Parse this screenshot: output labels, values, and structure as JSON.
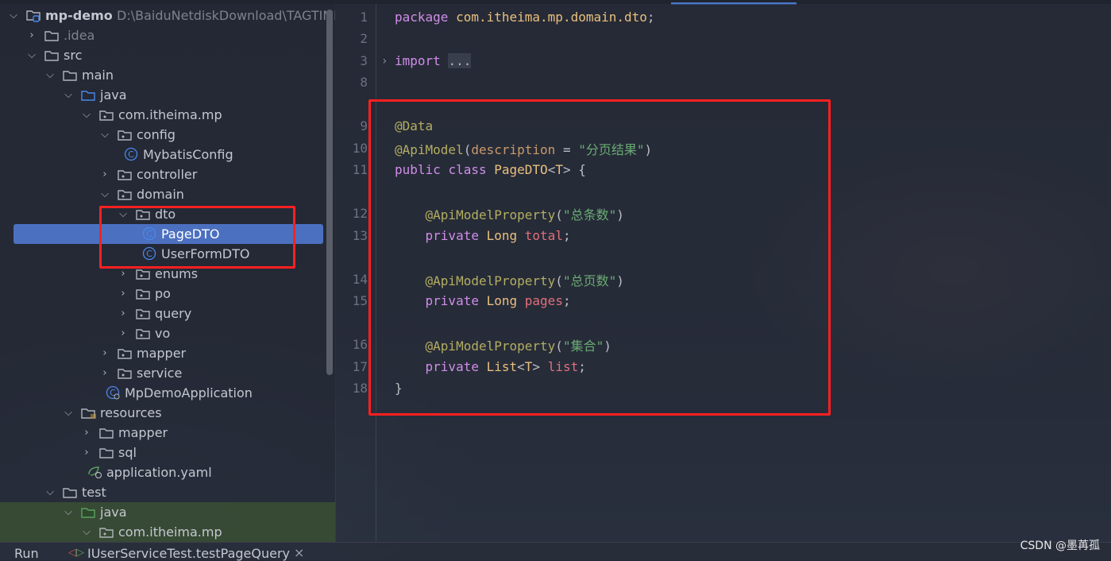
{
  "project": {
    "root_name": "mp-demo",
    "root_path": "D:\\BaiduNetdiskDownload\\TAGTIME",
    "items": [
      {
        "label": "mp-demo",
        "level": 0,
        "chev": "open",
        "icon": "module"
      },
      {
        "label": ".idea",
        "level": 1,
        "chev": "closed",
        "icon": "folder",
        "dim": true
      },
      {
        "label": "src",
        "level": 1,
        "chev": "open",
        "icon": "folder"
      },
      {
        "label": "main",
        "level": 2,
        "chev": "open",
        "icon": "folder"
      },
      {
        "label": "java",
        "level": 3,
        "chev": "open",
        "icon": "source-folder"
      },
      {
        "label": "com.itheima.mp",
        "level": 4,
        "chev": "open",
        "icon": "package"
      },
      {
        "label": "config",
        "level": 5,
        "chev": "open",
        "icon": "package"
      },
      {
        "label": "MybatisConfig",
        "level": 6,
        "chev": "none",
        "icon": "class"
      },
      {
        "label": "controller",
        "level": 5,
        "chev": "closed",
        "icon": "package"
      },
      {
        "label": "domain",
        "level": 5,
        "chev": "open",
        "icon": "package"
      },
      {
        "label": "dto",
        "level": 6,
        "chev": "open",
        "icon": "package"
      },
      {
        "label": "PageDTO",
        "level": 7,
        "chev": "none",
        "icon": "class",
        "selected": true
      },
      {
        "label": "UserFormDTO",
        "level": 7,
        "chev": "none",
        "icon": "class"
      },
      {
        "label": "enums",
        "level": 6,
        "chev": "closed",
        "icon": "package"
      },
      {
        "label": "po",
        "level": 6,
        "chev": "closed",
        "icon": "package"
      },
      {
        "label": "query",
        "level": 6,
        "chev": "closed",
        "icon": "package"
      },
      {
        "label": "vo",
        "level": 6,
        "chev": "closed",
        "icon": "package"
      },
      {
        "label": "mapper",
        "level": 5,
        "chev": "closed",
        "icon": "package"
      },
      {
        "label": "service",
        "level": 5,
        "chev": "closed",
        "icon": "package"
      },
      {
        "label": "MpDemoApplication",
        "level": 5,
        "chev": "none",
        "icon": "spring-class"
      },
      {
        "label": "resources",
        "level": 3,
        "chev": "open",
        "icon": "resources-folder"
      },
      {
        "label": "mapper",
        "level": 4,
        "chev": "closed",
        "icon": "folder"
      },
      {
        "label": "sql",
        "level": 4,
        "chev": "closed",
        "icon": "folder"
      },
      {
        "label": "application.yaml",
        "level": 4,
        "chev": "none",
        "icon": "spring-yaml"
      },
      {
        "label": "test",
        "level": 2,
        "chev": "open",
        "icon": "folder"
      },
      {
        "label": "java",
        "level": 3,
        "chev": "open",
        "icon": "test-folder",
        "green": true
      },
      {
        "label": "com.itheima.mp",
        "level": 4,
        "chev": "open",
        "icon": "package",
        "green": true
      }
    ]
  },
  "editor": {
    "lines": [
      {
        "n": "1",
        "tokens": [
          [
            "k",
            "package"
          ],
          [
            "d",
            " "
          ],
          [
            "t",
            "com.itheima.mp.domain.dto"
          ],
          [
            "d",
            ";"
          ]
        ]
      },
      {
        "n": "2",
        "tokens": []
      },
      {
        "n": "3",
        "fold": true,
        "tokens": [
          [
            "k",
            "import"
          ],
          [
            "d",
            " "
          ],
          [
            "m",
            "..."
          ]
        ]
      },
      {
        "n": "8",
        "tokens": []
      },
      {
        "n": "",
        "tokens": []
      },
      {
        "n": "9",
        "tokens": [
          [
            "a",
            "@Data"
          ]
        ]
      },
      {
        "n": "10",
        "tokens": [
          [
            "a",
            "@ApiModel"
          ],
          [
            "d",
            "("
          ],
          [
            "p",
            "description"
          ],
          [
            "d",
            " = "
          ],
          [
            "s",
            "\"分页结果\""
          ],
          [
            "d",
            ")"
          ]
        ]
      },
      {
        "n": "11",
        "tokens": [
          [
            "k",
            "public"
          ],
          [
            "d",
            " "
          ],
          [
            "k",
            "class"
          ],
          [
            "d",
            " "
          ],
          [
            "t",
            "PageDTO"
          ],
          [
            "d",
            "<"
          ],
          [
            "t",
            "T"
          ],
          [
            "d",
            "> {"
          ]
        ]
      },
      {
        "n": "",
        "tokens": []
      },
      {
        "n": "12",
        "tokens": [
          [
            "d",
            "    "
          ],
          [
            "a",
            "@ApiModelProperty"
          ],
          [
            "d",
            "("
          ],
          [
            "s",
            "\"总条数\""
          ],
          [
            "d",
            ")"
          ]
        ]
      },
      {
        "n": "13",
        "tokens": [
          [
            "d",
            "    "
          ],
          [
            "k",
            "private"
          ],
          [
            "d",
            " "
          ],
          [
            "t",
            "Long"
          ],
          [
            "d",
            " "
          ],
          [
            "f",
            "total"
          ],
          [
            "d",
            ";"
          ]
        ]
      },
      {
        "n": "",
        "tokens": []
      },
      {
        "n": "14",
        "tokens": [
          [
            "d",
            "    "
          ],
          [
            "a",
            "@ApiModelProperty"
          ],
          [
            "d",
            "("
          ],
          [
            "s",
            "\"总页数\""
          ],
          [
            "d",
            ")"
          ]
        ]
      },
      {
        "n": "15",
        "tokens": [
          [
            "d",
            "    "
          ],
          [
            "k",
            "private"
          ],
          [
            "d",
            " "
          ],
          [
            "t",
            "Long"
          ],
          [
            "d",
            " "
          ],
          [
            "f",
            "pages"
          ],
          [
            "d",
            ";"
          ]
        ]
      },
      {
        "n": "",
        "tokens": []
      },
      {
        "n": "16",
        "tokens": [
          [
            "d",
            "    "
          ],
          [
            "a",
            "@ApiModelProperty"
          ],
          [
            "d",
            "("
          ],
          [
            "s",
            "\"集合\""
          ],
          [
            "d",
            ")"
          ]
        ]
      },
      {
        "n": "17",
        "tokens": [
          [
            "d",
            "    "
          ],
          [
            "k",
            "private"
          ],
          [
            "d",
            " "
          ],
          [
            "t",
            "List"
          ],
          [
            "d",
            "<"
          ],
          [
            "t",
            "T"
          ],
          [
            "d",
            "> "
          ],
          [
            "f",
            "list"
          ],
          [
            "d",
            ";"
          ]
        ]
      },
      {
        "n": "18",
        "tokens": [
          [
            "d",
            "}"
          ]
        ]
      }
    ]
  },
  "bottom": {
    "run_label": "Run",
    "run_tab": "IUserServiceTest.testPageQuery",
    "close": "×"
  },
  "watermark": "CSDN @墨苒孤",
  "colors": {
    "accent": "#4c70c0",
    "highlight_box": "#ff2020"
  }
}
